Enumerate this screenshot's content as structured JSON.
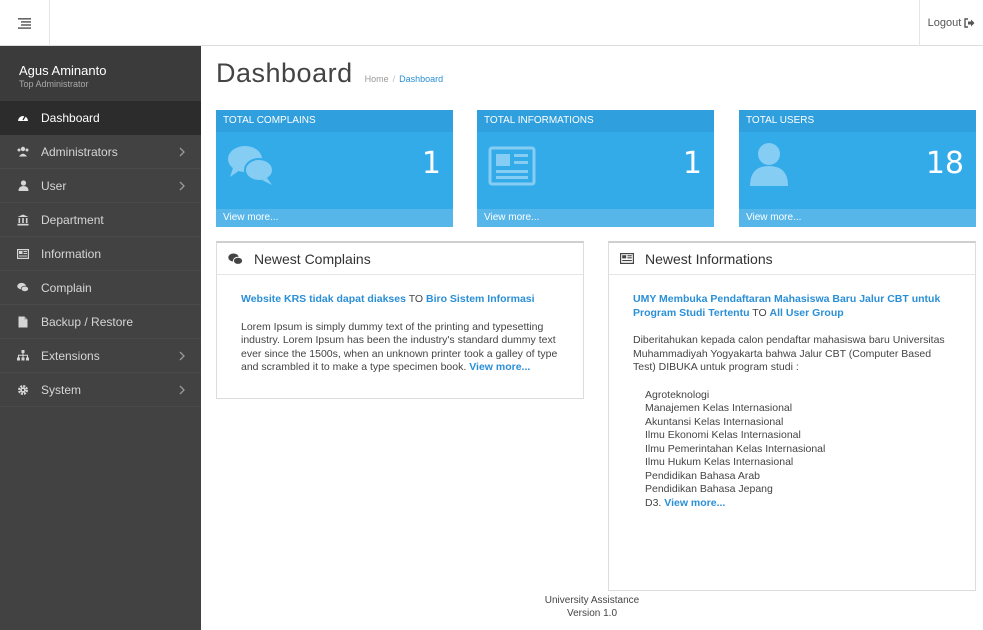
{
  "topbar": {
    "logout_label": "Logout"
  },
  "sidebar": {
    "user_name": "Agus Aminanto",
    "user_role": "Top Administrator",
    "items": [
      {
        "label": "Dashboard",
        "icon": "tachometer-icon",
        "active": true,
        "has_children": false
      },
      {
        "label": "Administrators",
        "icon": "users-icon",
        "active": false,
        "has_children": true
      },
      {
        "label": "User",
        "icon": "user-icon",
        "active": false,
        "has_children": true
      },
      {
        "label": "Department",
        "icon": "bank-icon",
        "active": false,
        "has_children": false
      },
      {
        "label": "Information",
        "icon": "newspaper-icon",
        "active": false,
        "has_children": false
      },
      {
        "label": "Complain",
        "icon": "comments-icon",
        "active": false,
        "has_children": false
      },
      {
        "label": "Backup / Restore",
        "icon": "file-icon",
        "active": false,
        "has_children": false
      },
      {
        "label": "Extensions",
        "icon": "sitemap-icon",
        "active": false,
        "has_children": true
      },
      {
        "label": "System",
        "icon": "gear-icon",
        "active": false,
        "has_children": true
      }
    ]
  },
  "header": {
    "title": "Dashboard",
    "breadcrumb_home": "Home",
    "breadcrumb_separator": "/",
    "breadcrumb_current": "Dashboard"
  },
  "stats": [
    {
      "label": "TOTAL COMPLAINS",
      "value": "1",
      "link": "View more...",
      "icon": "comments-icon"
    },
    {
      "label": "TOTAL INFORMATIONS",
      "value": "1",
      "link": "View more...",
      "icon": "newspaper-icon"
    },
    {
      "label": "TOTAL USERS",
      "value": "18",
      "link": "View more...",
      "icon": "user-icon"
    }
  ],
  "complains": {
    "heading": "Newest Complains",
    "title": "Website KRS tidak dapat diakses",
    "to_word": "TO",
    "recipient": "Biro Sistem Informasi",
    "text": "Lorem Ipsum is simply dummy text of the printing and typesetting industry. Lorem Ipsum has been the industry's standard dummy text ever since the 1500s, when an unknown printer took a galley of type and scrambled it to make a type specimen book.",
    "more": "View more..."
  },
  "informations": {
    "heading": "Newest Informations",
    "title": "UMY Membuka Pendaftaran Mahasiswa Baru Jalur CBT untuk Program Studi Tertentu",
    "to_word": "TO",
    "recipient": "All User Group",
    "text": "Diberitahukan kepada calon pendaftar mahasiswa baru Universitas Muhammadiyah Yogyakarta bahwa Jalur CBT (Computer Based Test) DIBUKA untuk program studi :",
    "programs": [
      "Agroteknologi",
      "Manajemen Kelas Internasional",
      "Akuntansi Kelas Internasional",
      "Ilmu Ekonomi Kelas Internasional",
      "Ilmu Pemerintahan Kelas Internasional",
      "Ilmu Hukum Kelas Internasional",
      "Pendidikan Bahasa Arab",
      "Pendidikan Bahasa Jepang",
      "D3."
    ],
    "more": "View more..."
  },
  "footer": {
    "line1": "University Assistance",
    "line2": "Version 1.0"
  },
  "colors": {
    "accent": "#32a7e6",
    "sidebar": "#424242",
    "sidebar_active": "#2c2c2c",
    "link": "#2a8fd6"
  }
}
